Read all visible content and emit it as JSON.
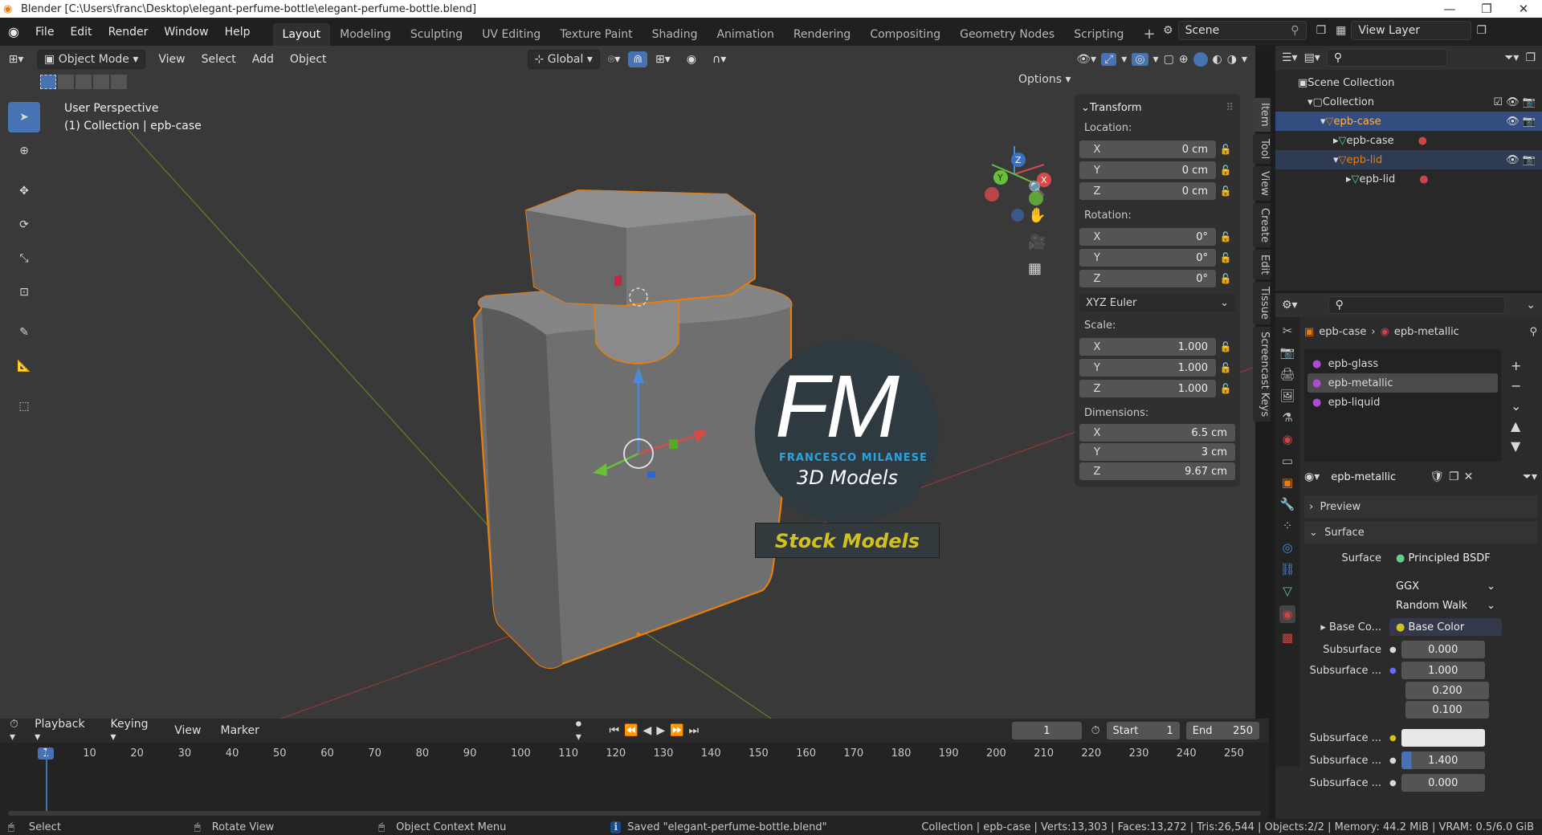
{
  "window": {
    "title": "Blender [C:\\Users\\franc\\Desktop\\elegant-perfume-bottle\\elegant-perfume-bottle.blend]",
    "controls": [
      "—",
      "❐",
      "✕"
    ]
  },
  "menu": [
    "File",
    "Edit",
    "Render",
    "Window",
    "Help"
  ],
  "workspaces": [
    "Layout",
    "Modeling",
    "Sculpting",
    "UV Editing",
    "Texture Paint",
    "Shading",
    "Animation",
    "Rendering",
    "Compositing",
    "Geometry Nodes",
    "Scripting"
  ],
  "scene": {
    "name": "Scene",
    "view_layer": "View Layer"
  },
  "viewport": {
    "mode": "Object Mode",
    "menus": [
      "View",
      "Select",
      "Add",
      "Object"
    ],
    "orientation": "Global",
    "options": "Options",
    "overlay_title": "User Perspective",
    "overlay_sub": "(1) Collection | epb-case",
    "side_tabs": [
      "Item",
      "Tool",
      "View",
      "Create",
      "Edit",
      "Tissue",
      "Screencast Keys"
    ]
  },
  "logo": {
    "fm": "FM",
    "company": "FRANCESCO MILANESE",
    "tagline": "3D Models",
    "banner": "Stock Models"
  },
  "transform": {
    "title": "Transform",
    "location_label": "Location:",
    "location": [
      {
        "axis": "X",
        "val": "0 cm"
      },
      {
        "axis": "Y",
        "val": "0 cm"
      },
      {
        "axis": "Z",
        "val": "0 cm"
      }
    ],
    "rotation_label": "Rotation:",
    "rotation": [
      {
        "axis": "X",
        "val": "0°"
      },
      {
        "axis": "Y",
        "val": "0°"
      },
      {
        "axis": "Z",
        "val": "0°"
      }
    ],
    "rotation_mode": "XYZ Euler",
    "scale_label": "Scale:",
    "scale": [
      {
        "axis": "X",
        "val": "1.000"
      },
      {
        "axis": "Y",
        "val": "1.000"
      },
      {
        "axis": "Z",
        "val": "1.000"
      }
    ],
    "dimensions_label": "Dimensions:",
    "dimensions": [
      {
        "axis": "X",
        "val": "6.5 cm"
      },
      {
        "axis": "Y",
        "val": "3 cm"
      },
      {
        "axis": "Z",
        "val": "9.67 cm"
      }
    ]
  },
  "outliner": {
    "root": "Scene Collection",
    "collection": "Collection",
    "items": [
      {
        "label": "epb-case",
        "sel": true
      },
      {
        "label": "epb-case",
        "sel": false
      },
      {
        "label": "epb-lid",
        "sel": false
      },
      {
        "label": "epb-lid",
        "sel": false
      }
    ]
  },
  "properties": {
    "breadcrumb_obj": "epb-case",
    "breadcrumb_mat": "epb-metallic",
    "materials": [
      "epb-glass",
      "epb-metallic",
      "epb-liquid"
    ],
    "material_name": "epb-metallic",
    "preview": "Preview",
    "surface_panel": "Surface",
    "surface_label": "Surface",
    "surface_value": "Principled BSDF",
    "distribution": "GGX",
    "subsurface_method": "Random Walk",
    "base_color_label": "Base Co...",
    "base_color_value": "Base Color",
    "rows": [
      {
        "label": "Subsurface",
        "value": "0.000"
      },
      {
        "label": "Subsurface ...",
        "values": [
          "1.000",
          "0.200",
          "0.100"
        ]
      },
      {
        "label": "Subsurface ...",
        "value": ""
      },
      {
        "label": "Subsurface ...",
        "value": "1.400"
      },
      {
        "label": "Subsurface ...",
        "value": "0.000"
      }
    ]
  },
  "timeline": {
    "menus": [
      "Playback",
      "Keying",
      "View",
      "Marker"
    ],
    "current": "1",
    "start_label": "Start",
    "start": "1",
    "end_label": "End",
    "end": "250",
    "ticks": [
      "1",
      "10",
      "20",
      "30",
      "40",
      "50",
      "60",
      "70",
      "80",
      "90",
      "100",
      "110",
      "120",
      "130",
      "140",
      "150",
      "160",
      "170",
      "180",
      "190",
      "200",
      "210",
      "220",
      "230",
      "240",
      "250"
    ]
  },
  "status": {
    "select": "Select",
    "rotate": "Rotate View",
    "context": "Object Context Menu",
    "message": "Saved \"elegant-perfume-bottle.blend\"",
    "stats": "Collection | epb-case | Verts:13,303 | Faces:13,272 | Tris:26,544 | Objects:2/2 | Memory: 44.2 MiB | VRAM: 0.5/6.0 GiB"
  },
  "colors": {
    "accent": "#4772b3",
    "selection": "#e87d0d",
    "viewport_bg": "#393939",
    "panel": "#303030"
  }
}
